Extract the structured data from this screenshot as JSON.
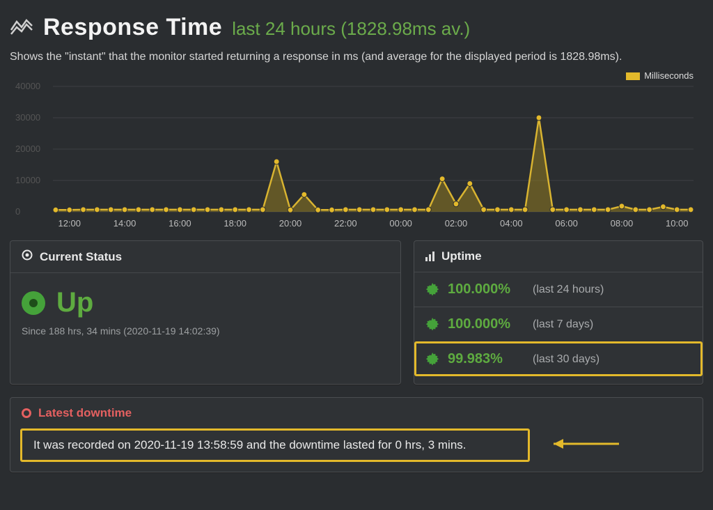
{
  "header": {
    "title": "Response Time",
    "subtitle": "last 24 hours  (1828.98ms av.)"
  },
  "description": "Shows the \"instant\" that the monitor started returning a response in ms (and average for the displayed period is 1828.98ms).",
  "chart_data": {
    "type": "line",
    "title": "Response Time",
    "xlabel": "",
    "ylabel": "",
    "ylim": [
      0,
      40000
    ],
    "yticks": [
      0,
      10000,
      20000,
      30000,
      40000
    ],
    "legend": "Milliseconds",
    "x": [
      "11:30",
      "12:00",
      "12:30",
      "13:00",
      "13:30",
      "14:00",
      "14:30",
      "15:00",
      "15:30",
      "16:00",
      "16:30",
      "17:00",
      "17:30",
      "18:00",
      "18:30",
      "19:00",
      "19:30",
      "20:00",
      "20:30",
      "21:00",
      "21:30",
      "22:00",
      "22:30",
      "23:00",
      "23:30",
      "00:00",
      "00:30",
      "01:00",
      "01:30",
      "02:00",
      "02:30",
      "03:00",
      "03:30",
      "04:00",
      "04:30",
      "05:00",
      "05:30",
      "06:00",
      "06:30",
      "07:00",
      "07:30",
      "08:00",
      "08:30",
      "09:00",
      "09:30",
      "10:00",
      "10:30"
    ],
    "values": [
      600,
      600,
      700,
      700,
      700,
      700,
      700,
      700,
      700,
      700,
      700,
      700,
      700,
      700,
      700,
      700,
      16000,
      600,
      5500,
      600,
      600,
      700,
      700,
      700,
      700,
      700,
      700,
      700,
      10500,
      2500,
      9000,
      700,
      700,
      700,
      700,
      30000,
      700,
      700,
      700,
      700,
      700,
      1800,
      700,
      700,
      1600,
      700,
      700
    ],
    "x_tick_labels": [
      "12:00",
      "14:00",
      "16:00",
      "18:00",
      "20:00",
      "22:00",
      "00:00",
      "02:00",
      "04:00",
      "06:00",
      "08:00",
      "10:00"
    ]
  },
  "status_panel": {
    "title": "Current Status",
    "state": "Up",
    "since": "Since 188 hrs, 34 mins (2020-11-19 14:02:39)"
  },
  "uptime_panel": {
    "title": "Uptime",
    "rows": [
      {
        "pct": "100.000%",
        "period": "(last 24 hours)",
        "highlight": false
      },
      {
        "pct": "100.000%",
        "period": "(last 7 days)",
        "highlight": false
      },
      {
        "pct": "99.983%",
        "period": "(last 30 days)",
        "highlight": true
      }
    ]
  },
  "downtime_panel": {
    "title": "Latest downtime",
    "message": "It was recorded on 2020-11-19 13:58:59 and the downtime lasted for 0 hrs, 3 mins."
  }
}
